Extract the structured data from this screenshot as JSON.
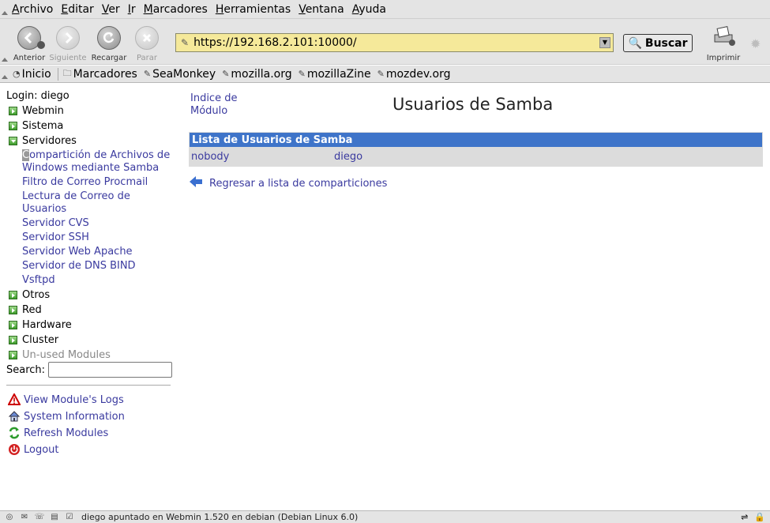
{
  "menubar": {
    "items": [
      "Archivo",
      "Editar",
      "Ver",
      "Ir",
      "Marcadores",
      "Herramientas",
      "Ventana",
      "Ayuda"
    ]
  },
  "navbar": {
    "back_label": "Anterior",
    "forward_label": "Siguiente",
    "reload_label": "Recargar",
    "stop_label": "Parar",
    "url": "https://192.168.2.101:10000/",
    "search_label": "Buscar",
    "print_label": "Imprimir"
  },
  "bookmarks": {
    "home": "Inicio",
    "folder": "Marcadores",
    "items": [
      "SeaMonkey",
      "mozilla.org",
      "mozillaZine",
      "mozdev.org"
    ]
  },
  "sidebar": {
    "login": "Login: diego",
    "categories": {
      "webmin": "Webmin",
      "sistema": "Sistema",
      "servidores": "Servidores",
      "otros": "Otros",
      "red": "Red",
      "hardware": "Hardware",
      "cluster": "Cluster",
      "unused": "Un-used Modules"
    },
    "servers": [
      "Compartición de Archivos de Windows mediante Samba",
      "Filtro de Correo Procmail",
      "Lectura de Correo de Usuarios",
      "Servidor CVS",
      "Servidor SSH",
      "Servidor Web Apache",
      "Servidor de DNS BIND",
      "Vsftpd"
    ],
    "search_label": "Search:",
    "search_value": "",
    "actions": {
      "logs": "View Module's Logs",
      "sysinfo": "System Information",
      "refresh": "Refresh Modules",
      "logout": "Logout"
    }
  },
  "main": {
    "index_link": "Indice de Módulo",
    "title": "Usuarios de Samba",
    "table_header": "Lista de Usuarios de Samba",
    "users": [
      "nobody",
      "diego"
    ],
    "back_link": "Regresar a lista de comparticiones"
  },
  "statusbar": {
    "text": "diego apuntado en Webmin 1.520 en debian (Debian Linux 6.0)"
  }
}
